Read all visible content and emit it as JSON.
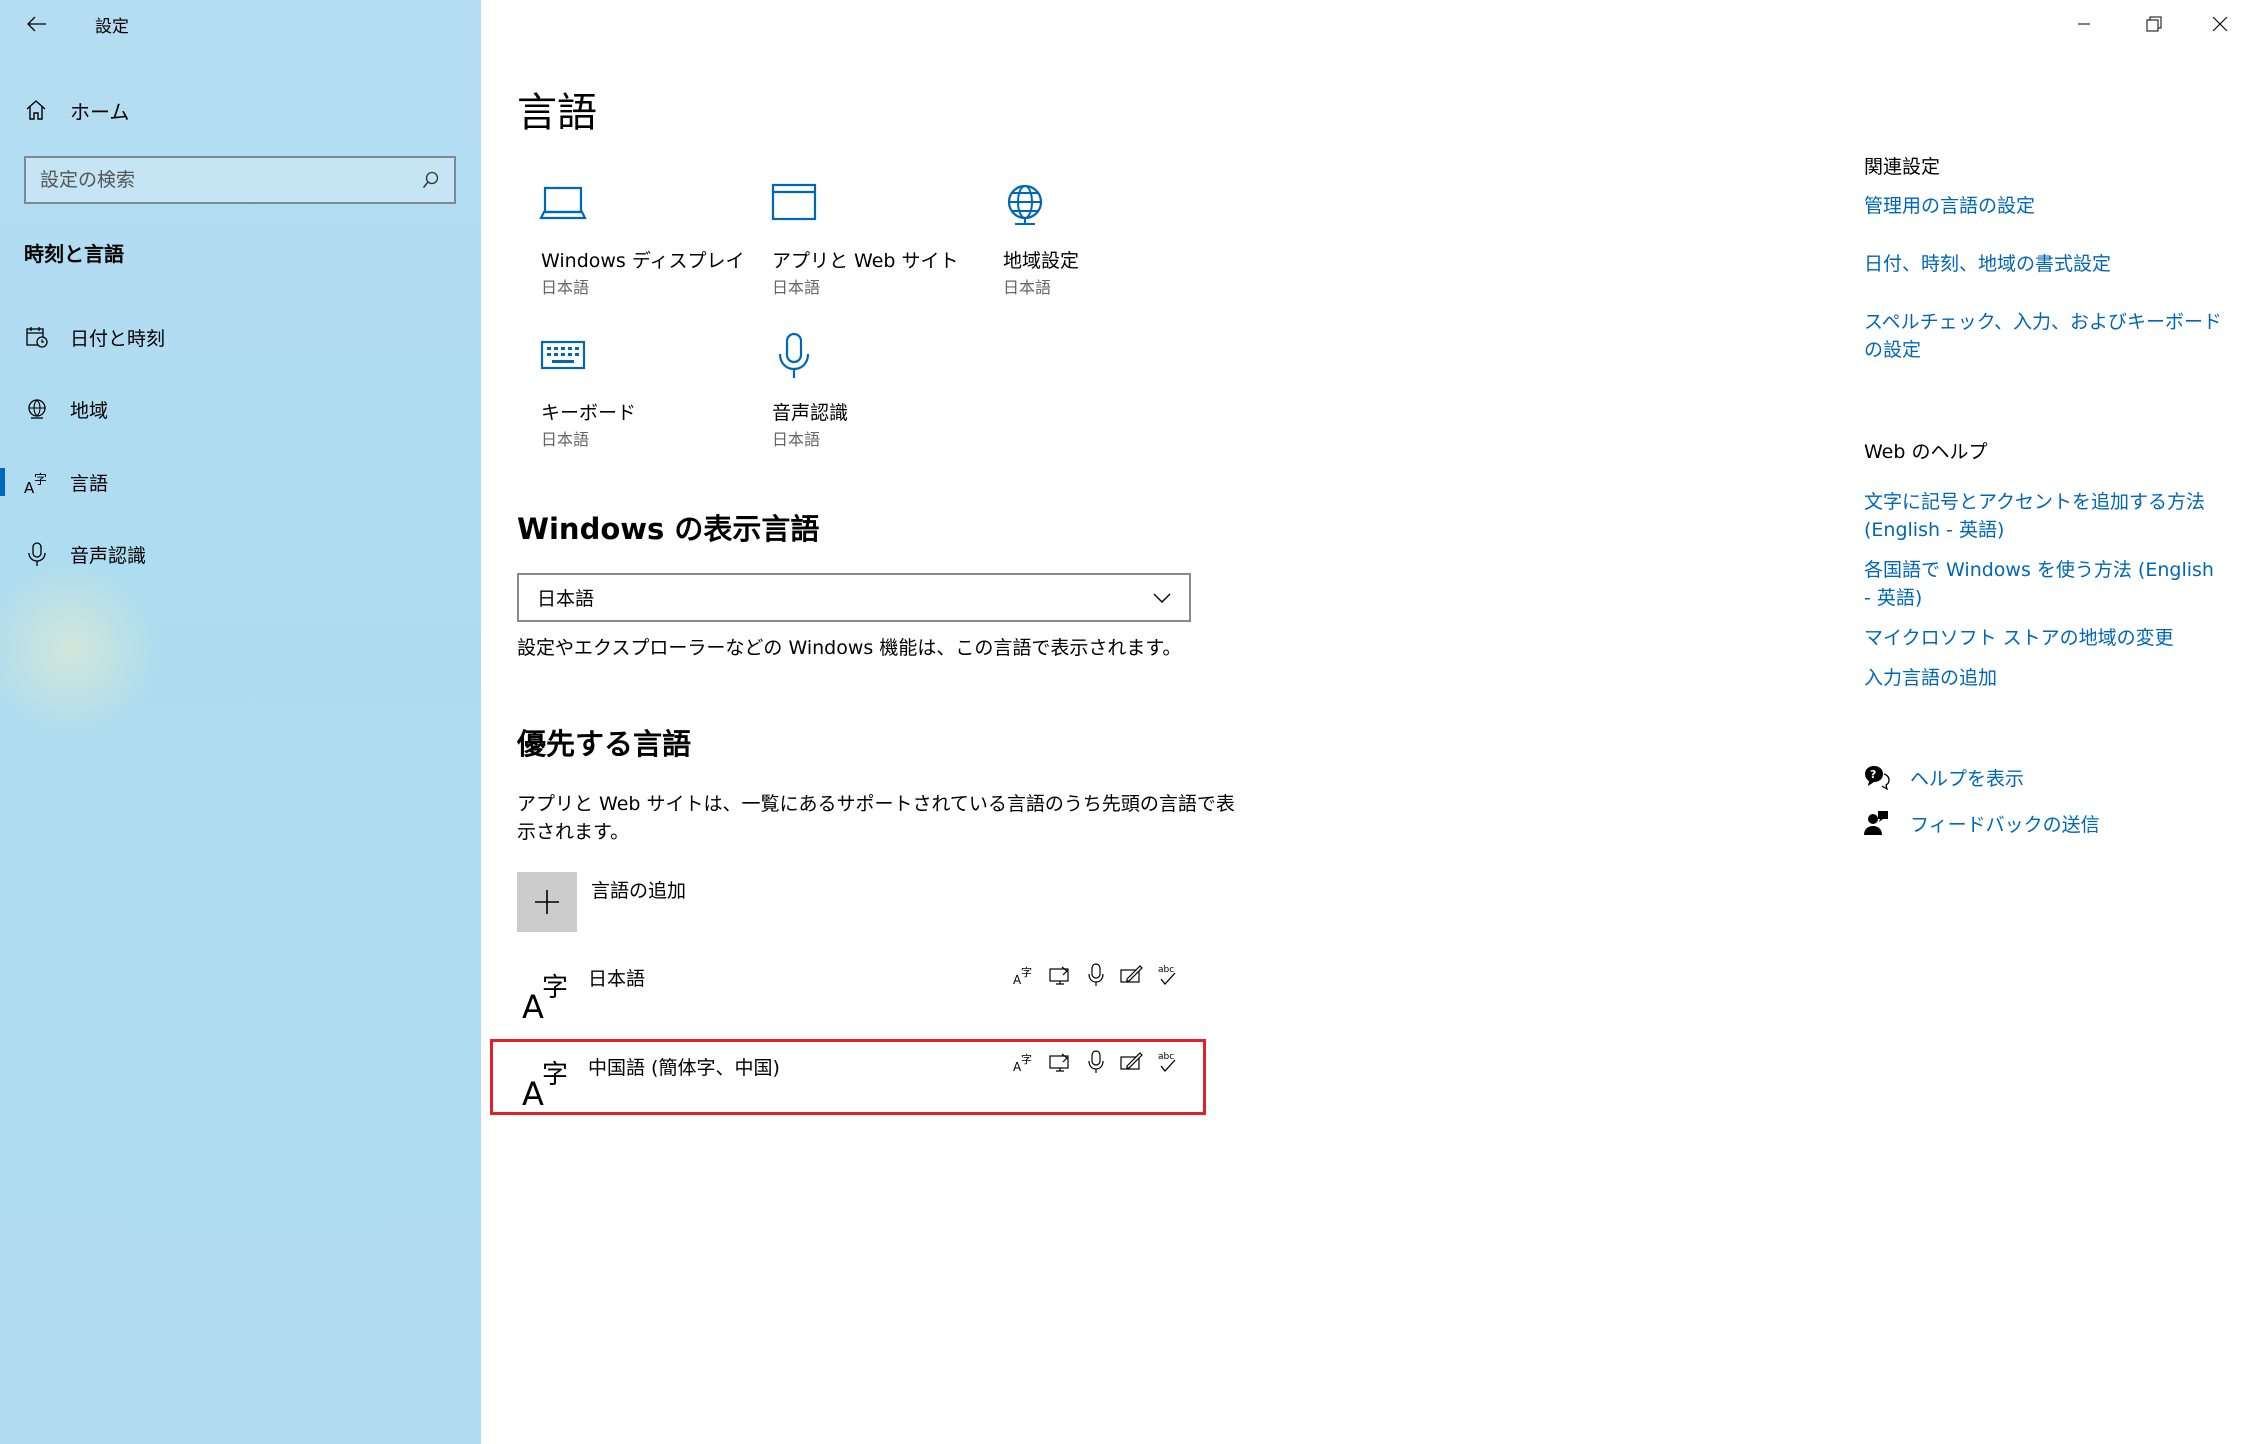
{
  "window": {
    "title": "設定",
    "controls": [
      "minimize",
      "restore",
      "close"
    ]
  },
  "sidebar": {
    "home_label": "ホーム",
    "search_placeholder": "設定の検索",
    "section_title": "時刻と言語",
    "items": [
      {
        "label": "日付と時刻",
        "icon": "calendar-clock-icon"
      },
      {
        "label": "地域",
        "icon": "globe-region-icon"
      },
      {
        "label": "言語",
        "icon": "language-icon",
        "active": true
      },
      {
        "label": "音声認識",
        "icon": "microphone-icon"
      }
    ]
  },
  "main": {
    "title": "言語",
    "tiles": [
      {
        "label": "Windows ディスプレイ",
        "sub": "日本語",
        "icon": "laptop-icon"
      },
      {
        "label": "アプリと Web サイト",
        "sub": "日本語",
        "icon": "window-icon"
      },
      {
        "label": "地域設定",
        "sub": "日本語",
        "icon": "globe-icon"
      },
      {
        "label": "キーボード",
        "sub": "日本語",
        "icon": "keyboard-icon"
      },
      {
        "label": "音声認識",
        "sub": "日本語",
        "icon": "microphone-icon"
      }
    ],
    "display_language": {
      "heading": "Windows の表示言語",
      "selected": "日本語",
      "description": "設定やエクスプローラーなどの Windows 機能は、この言語で表示されます。"
    },
    "preferred": {
      "heading": "優先する言語",
      "description_line1": "アプリと Web サイトは、一覧にあるサポートされている言語のうち先頭の言語で表",
      "description_line2": "示されます。",
      "add_label": "言語の追加",
      "languages": [
        {
          "name": "日本語",
          "features": [
            "display-language-icon",
            "text-to-speech-icon",
            "speech-recognition-icon",
            "handwriting-icon",
            "spellcheck-icon"
          ]
        },
        {
          "name": "中国語 (簡体字、中国)",
          "features": [
            "display-language-icon",
            "text-to-speech-icon",
            "speech-recognition-icon",
            "handwriting-icon",
            "spellcheck-icon"
          ],
          "highlighted": true
        }
      ]
    }
  },
  "right": {
    "related_heading": "関連設定",
    "related_links": [
      "管理用の言語の設定",
      "日付、時刻、地域の書式設定",
      "スペルチェック、入力、およびキーボードの設定"
    ],
    "web_heading": "Web のヘルプ",
    "web_links": [
      "文字に記号とアクセントを追加する方法 (English - 英語)",
      "各国語で Windows を使う方法 (English - 英語)",
      "マイクロソフト ストアの地域の変更",
      "入力言語の追加"
    ],
    "help_label": "ヘルプを表示",
    "feedback_label": "フィードバックの送信"
  },
  "colors": {
    "accent": "#0067b8",
    "sidebar_bg": "#b0dcf0",
    "highlight_border": "#e3202a"
  }
}
